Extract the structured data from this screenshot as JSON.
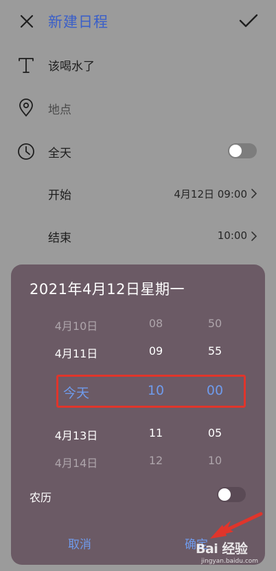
{
  "header": {
    "title": "新建日程"
  },
  "form": {
    "title_value": "该喝水了",
    "location_placeholder": "地点",
    "all_day_label": "全天",
    "start_label": "开始",
    "start_value": "4月12日 09:00",
    "end_label": "结束",
    "end_value": "10:00"
  },
  "picker": {
    "heading": "2021年4月12日星期一",
    "dates": [
      "4月10日",
      "4月11日",
      "今天",
      "4月13日",
      "4月14日"
    ],
    "hours": [
      "08",
      "09",
      "10",
      "11",
      "12"
    ],
    "minutes": [
      "50",
      "55",
      "00",
      "05",
      "10"
    ],
    "lunar_label": "农历",
    "cancel_label": "取消",
    "ok_label": "确定"
  },
  "watermark": {
    "logo": "Bai 经验",
    "url": "jingyan.baidu.com"
  },
  "colors": {
    "accent": "#6f9bec",
    "title_blue": "#3a5fc9",
    "sheet_bg": "#6b5a65",
    "highlight": "#e0352b"
  }
}
